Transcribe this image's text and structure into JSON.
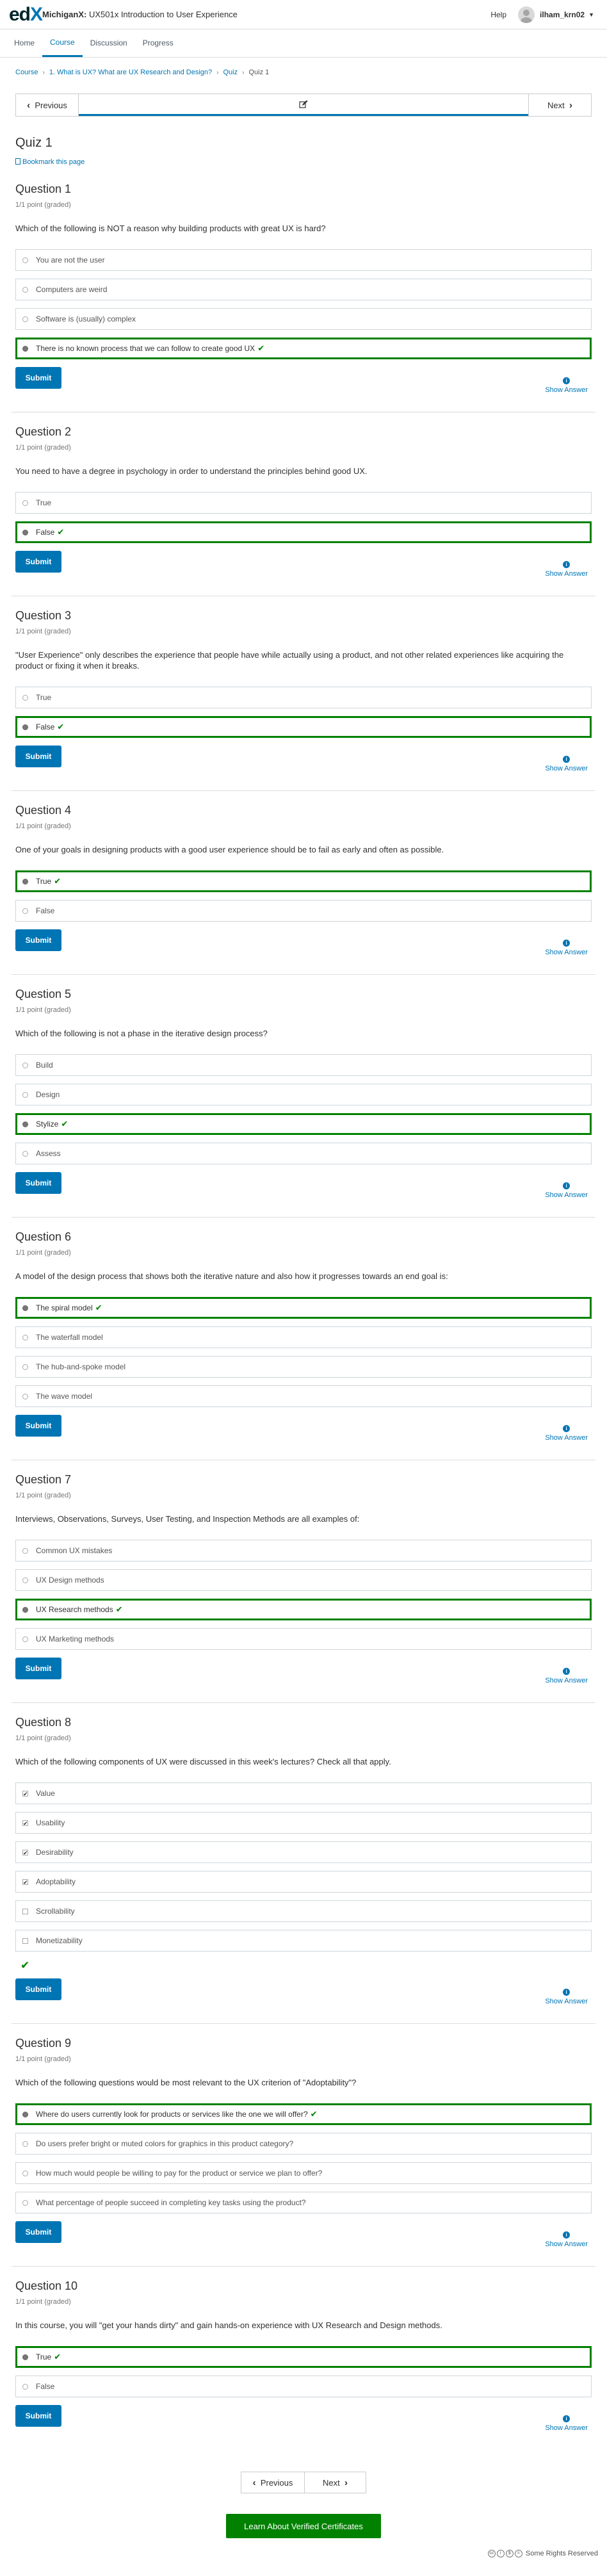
{
  "header": {
    "logo_part1": "ed",
    "logo_part2": "X",
    "course_org": "MichiganX:",
    "course_name": " UX501x Introduction to User Experience",
    "help": "Help",
    "username": "ilham_krn02"
  },
  "tabs": [
    "Home",
    "Course",
    "Discussion",
    "Progress"
  ],
  "breadcrumb": [
    "Course",
    "1. What is UX? What are UX Research and Design?",
    "Quiz",
    "Quiz 1"
  ],
  "sequence": {
    "previous": "Previous",
    "next": "Next"
  },
  "unit_title": "Quiz 1",
  "bookmark": "Bookmark this page",
  "submit_label": "Submit",
  "show_answer_label": "Show Answer",
  "questions": [
    {
      "title": "Question 1",
      "points": "1/1 point (graded)",
      "prompt": "Which of the following is NOT a reason why building products with great UX is hard?",
      "type": "radio",
      "options": [
        {
          "label": "You are not the user",
          "selected": false,
          "correct": false
        },
        {
          "label": "Computers are weird",
          "selected": false,
          "correct": false
        },
        {
          "label": "Software is (usually) complex",
          "selected": false,
          "correct": false
        },
        {
          "label": "There is no known process that we can follow to create good UX",
          "selected": true,
          "correct": true
        }
      ]
    },
    {
      "title": "Question 2",
      "points": "1/1 point (graded)",
      "prompt": "You need to have a degree in psychology in order to understand the principles behind good UX.",
      "type": "radio",
      "options": [
        {
          "label": "True",
          "selected": false,
          "correct": false
        },
        {
          "label": "False",
          "selected": true,
          "correct": true
        }
      ]
    },
    {
      "title": "Question 3",
      "points": "1/1 point (graded)",
      "prompt": "\"User Experience\" only describes the experience that people have while actually using a product, and not other related experiences like acquiring the product or fixing it when it breaks.",
      "type": "radio",
      "options": [
        {
          "label": "True",
          "selected": false,
          "correct": false
        },
        {
          "label": "False",
          "selected": true,
          "correct": true
        }
      ]
    },
    {
      "title": "Question 4",
      "points": "1/1 point (graded)",
      "prompt": "One of your goals in designing products with a good user experience should be to fail as early and often as possible.",
      "type": "radio",
      "options": [
        {
          "label": "True",
          "selected": true,
          "correct": true
        },
        {
          "label": "False",
          "selected": false,
          "correct": false
        }
      ]
    },
    {
      "title": "Question 5",
      "points": "1/1 point (graded)",
      "prompt": "Which of the following is not a phase in the iterative design process?",
      "type": "radio",
      "options": [
        {
          "label": "Build",
          "selected": false,
          "correct": false
        },
        {
          "label": "Design",
          "selected": false,
          "correct": false
        },
        {
          "label": "Stylize",
          "selected": true,
          "correct": true
        },
        {
          "label": "Assess",
          "selected": false,
          "correct": false
        }
      ]
    },
    {
      "title": "Question 6",
      "points": "1/1 point (graded)",
      "prompt": "A model of the design process that shows both the iterative nature and also how it progresses towards an end goal is:",
      "type": "radio",
      "options": [
        {
          "label": "The spiral model",
          "selected": true,
          "correct": true
        },
        {
          "label": "The waterfall model",
          "selected": false,
          "correct": false
        },
        {
          "label": "The hub-and-spoke model",
          "selected": false,
          "correct": false
        },
        {
          "label": "The wave model",
          "selected": false,
          "correct": false
        }
      ]
    },
    {
      "title": "Question 7",
      "points": "1/1 point (graded)",
      "prompt": "Interviews, Observations, Surveys, User Testing, and Inspection Methods are all examples of:",
      "type": "radio",
      "options": [
        {
          "label": "Common UX mistakes",
          "selected": false,
          "correct": false
        },
        {
          "label": "UX Design methods",
          "selected": false,
          "correct": false
        },
        {
          "label": "UX Research methods",
          "selected": true,
          "correct": true
        },
        {
          "label": "UX Marketing methods",
          "selected": false,
          "correct": false
        }
      ]
    },
    {
      "title": "Question 8",
      "points": "1/1 point (graded)",
      "prompt": "Which of the following components of UX were discussed in this week's lectures? Check all that apply.",
      "type": "checkbox",
      "options": [
        {
          "label": "Value",
          "selected": true,
          "correct": false
        },
        {
          "label": "Usability",
          "selected": true,
          "correct": false
        },
        {
          "label": "Desirability",
          "selected": true,
          "correct": false
        },
        {
          "label": "Adoptability",
          "selected": true,
          "correct": false
        },
        {
          "label": "Scrollability",
          "selected": false,
          "correct": false
        },
        {
          "label": "Monetizability",
          "selected": false,
          "correct": false
        }
      ],
      "group_correct": true
    },
    {
      "title": "Question 9",
      "points": "1/1 point (graded)",
      "prompt": "Which of the following questions would be most relevant to the UX criterion of \"Adoptability\"?",
      "type": "radio",
      "options": [
        {
          "label": "Where do users currently look for products or services like the one we will offer?",
          "selected": true,
          "correct": true
        },
        {
          "label": "Do users prefer bright or muted colors for graphics in this product category?",
          "selected": false,
          "correct": false
        },
        {
          "label": "How much would people be willing to pay for the product or service we plan to offer?",
          "selected": false,
          "correct": false
        },
        {
          "label": "What percentage of people succeed in completing key tasks using the product?",
          "selected": false,
          "correct": false
        }
      ]
    },
    {
      "title": "Question 10",
      "points": "1/1 point (graded)",
      "prompt": "In this course, you will \"get your hands dirty\" and gain hands-on experience with UX Research and Design methods.",
      "type": "radio",
      "options": [
        {
          "label": "True",
          "selected": true,
          "correct": true
        },
        {
          "label": "False",
          "selected": false,
          "correct": false
        }
      ]
    }
  ],
  "bottom_nav": {
    "previous": "Previous",
    "next": "Next"
  },
  "certificate_button": "Learn About Verified Certificates",
  "footer": {
    "rights": "Some Rights Reserved"
  },
  "colors": {
    "accent": "#0075b4",
    "correct": "#008100"
  }
}
